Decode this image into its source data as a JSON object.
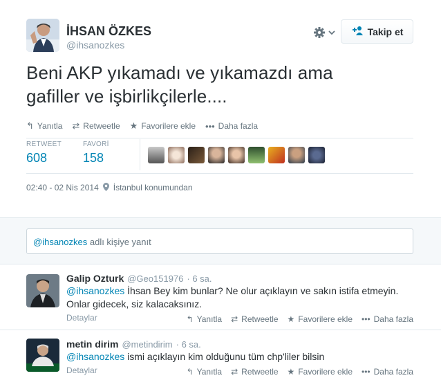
{
  "author": {
    "fullname": "İHSAN ÖZKES",
    "username": "@ihsanozkes"
  },
  "header": {
    "settings_icon": "gear-icon",
    "follow_label": "Takip et"
  },
  "tweet": {
    "text_line1": "Beni AKP yıkamadı ve yıkamazdı ama",
    "text_line2": "gafiller ve işbirlikçilerle....",
    "actions": {
      "reply": "Yanıtla",
      "retweet": "Retweetle",
      "favorite": "Favorilere ekle",
      "more": "Daha fazla"
    },
    "stats": {
      "retweet_label": "RETWEET",
      "retweet_count": "608",
      "favorite_label": "FAVORİ",
      "favorite_count": "158"
    },
    "timestamp": "02:40 - 02 Nis 2014",
    "location": "İstanbul konumundan"
  },
  "reply_box": {
    "mention": "@ihsanozkes",
    "suffix": " adlı kişiye yanıt"
  },
  "replies": [
    {
      "name": "Galip Ozturk",
      "username": "@Geo151976",
      "time": "· 6 sa.",
      "mention": "@ihsanozkes",
      "text": " İhsan Bey kim bunlar? Ne olur açıklayın ve sakın istifa etmeyin.",
      "text2": "Onlar gidecek, siz kalacaksınız.",
      "details": "Detaylar",
      "reply": "Yanıtla",
      "retweet": "Retweetle",
      "favorite": "Favorilere ekle",
      "more": "Daha fazla"
    },
    {
      "name": "metin dirim",
      "username": "@metindirim",
      "time": "· 6 sa.",
      "mention": "@ihsanozkes",
      "text": " ismi açıklayın kim olduğunu tüm chp'liler bilsin",
      "details": "Detaylar",
      "reply": "Yanıtla",
      "retweet": "Retweetle",
      "favorite": "Favorilere ekle",
      "more": "Daha fazla"
    }
  ],
  "colors": {
    "link": "#0084b4",
    "muted": "#8899a6",
    "text": "#292f33"
  }
}
